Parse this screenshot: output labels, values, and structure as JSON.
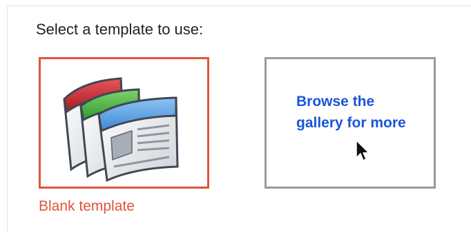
{
  "prompt": "Select a template to use:",
  "templates": {
    "blank": {
      "label": "Blank template",
      "icon": "stacked-pages-icon",
      "selected": true,
      "border_color": "#e0533b"
    },
    "gallery": {
      "label": "Browse the gallery for more",
      "border_color": "#9a9a9a",
      "link_color": "#1a56d6"
    }
  },
  "pointer": "arrow-cursor-icon"
}
